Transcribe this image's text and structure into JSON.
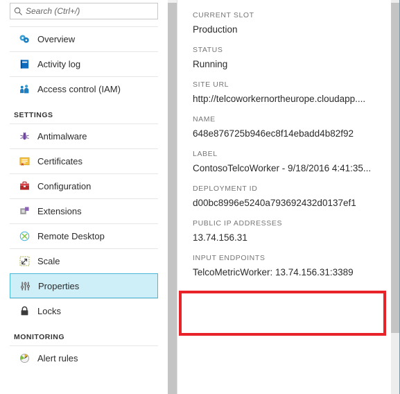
{
  "search": {
    "placeholder": "Search (Ctrl+/)",
    "value": "",
    "icon": "search-icon"
  },
  "sidebar": {
    "top_items": [
      {
        "label": "Overview",
        "icon": "overview-cloud-icon"
      },
      {
        "label": "Activity log",
        "icon": "activity-log-book-icon"
      },
      {
        "label": "Access control (IAM)",
        "icon": "access-control-people-icon"
      }
    ],
    "sections": [
      {
        "title": "SETTINGS",
        "items": [
          {
            "label": "Antimalware",
            "icon": "antimalware-bug-icon",
            "selected": false
          },
          {
            "label": "Certificates",
            "icon": "certificate-icon",
            "selected": false
          },
          {
            "label": "Configuration",
            "icon": "configuration-toolbox-icon",
            "selected": false
          },
          {
            "label": "Extensions",
            "icon": "extensions-icon",
            "selected": false
          },
          {
            "label": "Remote Desktop",
            "icon": "remote-desktop-icon",
            "selected": false
          },
          {
            "label": "Scale",
            "icon": "scale-icon",
            "selected": false
          },
          {
            "label": "Properties",
            "icon": "properties-sliders-icon",
            "selected": true
          },
          {
            "label": "Locks",
            "icon": "locks-padlock-icon",
            "selected": false
          }
        ]
      },
      {
        "title": "MONITORING",
        "items": [
          {
            "label": "Alert rules",
            "icon": "alert-rules-gauge-icon",
            "selected": false
          }
        ]
      }
    ]
  },
  "details": {
    "properties": [
      {
        "key": "CURRENT SLOT",
        "value": "Production"
      },
      {
        "key": "STATUS",
        "value": "Running"
      },
      {
        "key": "SITE URL",
        "value": "http://telcoworkernortheurope.cloudapp...."
      },
      {
        "key": "NAME",
        "value": "648e876725b946ec8f14ebadd4b82f92"
      },
      {
        "key": "LABEL",
        "value": "ContosoTelcoWorker - 9/18/2016 4:41:35..."
      },
      {
        "key": "DEPLOYMENT ID",
        "value": "d00bc8996e5240a793692432d0137ef1"
      },
      {
        "key": "PUBLIC IP ADDRESSES",
        "value": "13.74.156.31"
      },
      {
        "key": "INPUT ENDPOINTS",
        "value": "TelcoMetricWorker: 13.74.156.31:3389"
      }
    ]
  },
  "annotation": {
    "color": "#e8232a",
    "highlights": "PUBLIC IP ADDRESSES"
  },
  "colors": {
    "selected_bg": "#cfeff8",
    "selected_border": "#4ab6d8",
    "key_text": "#767676",
    "value_text": "#2b2b2b",
    "annotation_red": "#e8232a"
  }
}
